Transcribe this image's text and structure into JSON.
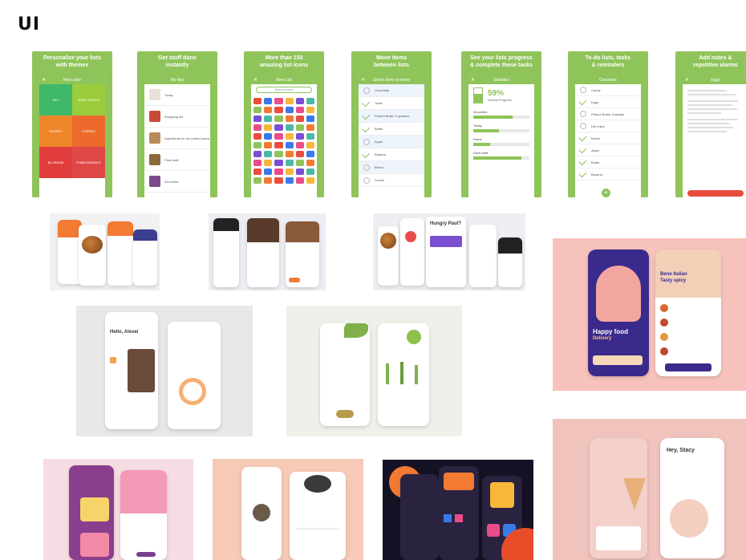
{
  "page": {
    "title": "UI"
  },
  "onboarding": [
    {
      "caption": "Personalize your lists\nwith themes",
      "screen": "themes",
      "nav": "New color",
      "tiles": [
        {
          "label": "SKY",
          "color": "#3fb86a"
        },
        {
          "label": "BABY GREEN",
          "color": "#9bcc3c"
        },
        {
          "label": "SUNSET",
          "color": "#f0862a"
        },
        {
          "label": "CHERRY",
          "color": "#ec6b2c"
        },
        {
          "label": "BLOSSOM",
          "color": "#e23d3d"
        },
        {
          "label": "POMEGRANATE",
          "color": "#e04848"
        }
      ]
    },
    {
      "caption": "Get stuff done\ninstantly",
      "screen": "lists",
      "nav": "My lists",
      "rows": [
        "Today",
        "Shopping list",
        "Ingredients for the perfect pizza",
        "Pack stuff",
        "Groceries"
      ]
    },
    {
      "caption": "More than 150\namazing list icons",
      "screen": "icons",
      "nav": "New List",
      "search": "Search icons"
    },
    {
      "caption": "Move items\nbetween lists",
      "screen": "move",
      "nav": "Select items to move",
      "rows": [
        "Chocolate",
        "Toast",
        "Peanut Butter Cupcakes",
        "Butter",
        "Apple",
        "Banana",
        "Bread",
        "Cereal"
      ]
    },
    {
      "caption": "See your lists progress\n& complete these tasks",
      "screen": "progress",
      "nav": "Statistics",
      "percent": "59%",
      "percent_label": "Overall Progress",
      "bars": [
        {
          "label": "Groceries",
          "fill": 0.7
        },
        {
          "label": "Today",
          "fill": 0.45
        },
        {
          "label": "Home",
          "fill": 0.3
        },
        {
          "label": "Done stuff",
          "fill": 0.85
        }
      ]
    },
    {
      "caption": "To-do lists, tasks\n& reminders",
      "screen": "todo",
      "nav": "Groceries",
      "rows": [
        "Candy",
        "Eggs",
        "Peanut Butter Cupcake",
        "Hot chips",
        "Bread",
        "Apple",
        "Butter",
        "Banana"
      ]
    },
    {
      "caption": "Add notes &\nrepetitive alarms",
      "screen": "notes",
      "nav": "Eggs"
    }
  ],
  "colors": {
    "green": "#8fc45a",
    "ice_bg": "#f0c3bd",
    "food_bg": "#f7c2bb",
    "purple": "#3a2a8c"
  }
}
